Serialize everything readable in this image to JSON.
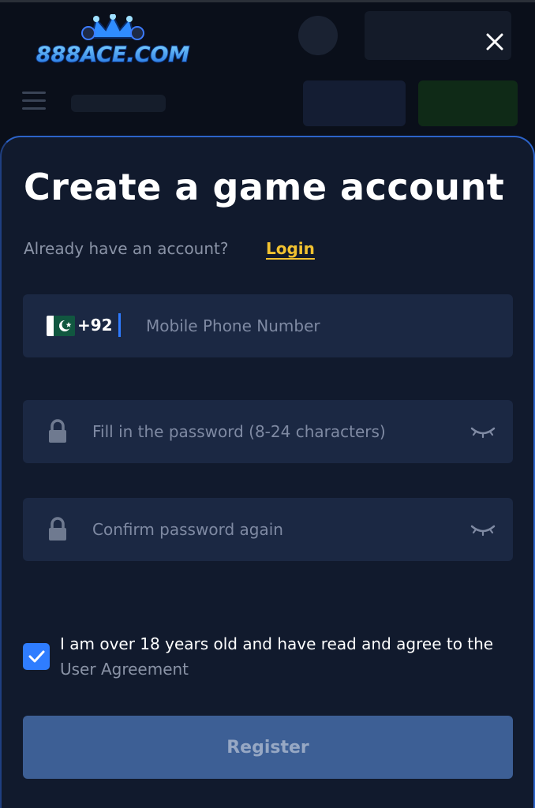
{
  "header": {
    "logo_text": "888ACE.COM",
    "close_icon": "close-icon"
  },
  "modal": {
    "title": "Create a game account",
    "already_text": "Already have an account?",
    "login_label": "Login"
  },
  "phone": {
    "flag_icon": "pakistan-flag-icon",
    "country_code": "+92",
    "placeholder": "Mobile Phone Number",
    "value": ""
  },
  "password": {
    "placeholder": "Fill in the password (8-24 characters)",
    "value": "",
    "lock_icon": "lock-icon",
    "eye_icon": "eye-closed-icon"
  },
  "confirm_password": {
    "placeholder": "Confirm password again",
    "value": "",
    "lock_icon": "lock-icon",
    "eye_icon": "eye-closed-icon"
  },
  "agreement": {
    "checked": true,
    "text": "I am over 18 years old and have read and agree to the",
    "link_label": "User Agreement"
  },
  "register_label": "Register",
  "colors": {
    "accent_blue": "#2f7dff",
    "login_yellow": "#f2c230",
    "panel_bg": "#111a2d",
    "field_bg": "#1b2843",
    "register_bg": "#3d5f95"
  }
}
